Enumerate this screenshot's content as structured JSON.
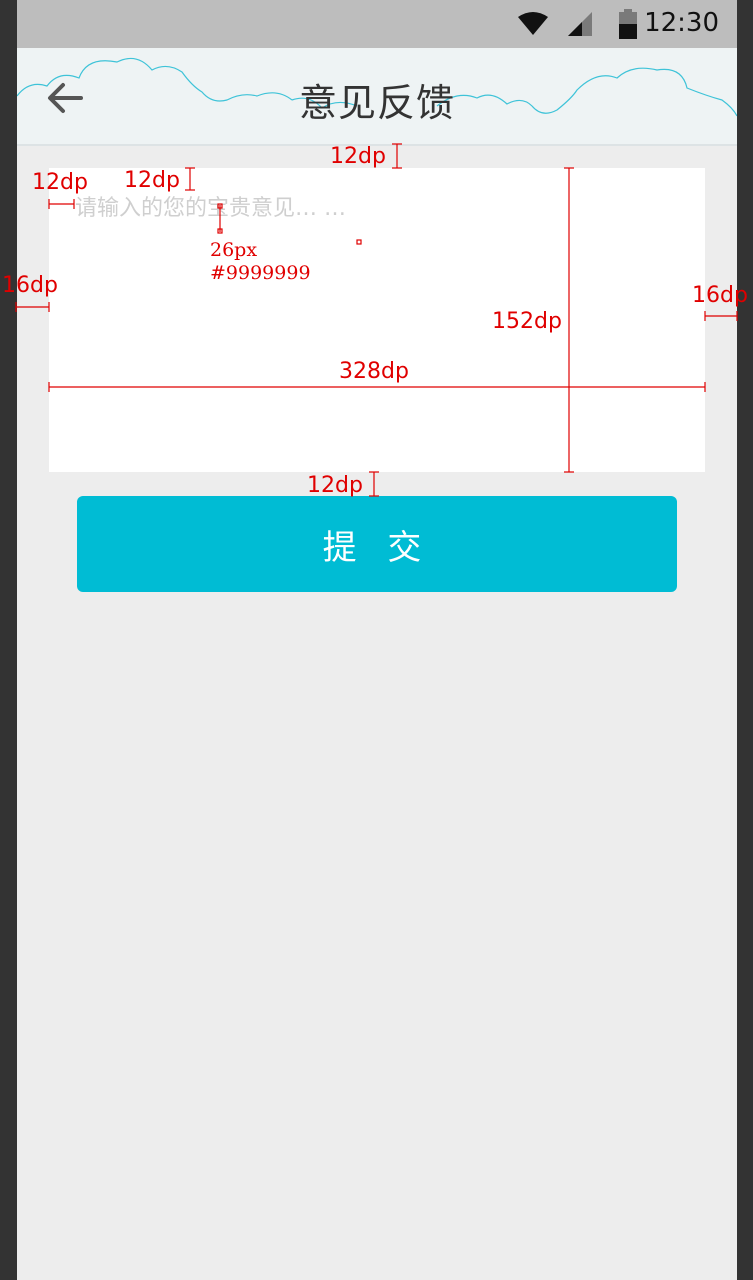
{
  "status_bar": {
    "time": "12:30",
    "icons": [
      "wifi-icon",
      "signal-icon",
      "battery-icon"
    ]
  },
  "header": {
    "title": "意见反馈",
    "back_icon": "arrow-left-icon"
  },
  "feedback": {
    "placeholder": "请输入的您的宝贵意见… …",
    "value": ""
  },
  "submit": {
    "label": "提 交"
  },
  "annotations": {
    "top_gap": "12dp",
    "text_left_padding": "12dp",
    "text_top_padding": "12dp",
    "left_margin": "16dp",
    "right_margin": "16dp",
    "box_height": "152dp",
    "box_width": "328dp",
    "button_gap": "12dp",
    "font_size": "26px",
    "font_color": "#9999999"
  },
  "colors": {
    "accent": "#00bcd4",
    "page_bg": "#ededed",
    "header_bg": "#eef3f4",
    "annotation": "#e00000"
  }
}
